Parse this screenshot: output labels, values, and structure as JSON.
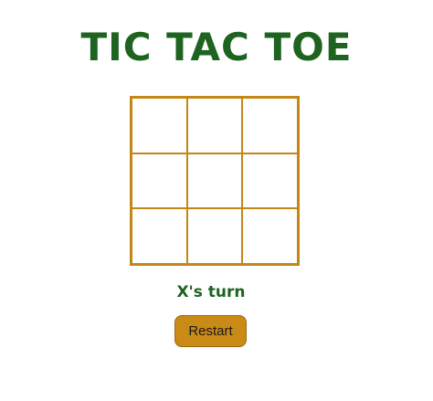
{
  "game": {
    "title": "TIC TAC TOE",
    "status": "X's turn",
    "restart_label": "Restart",
    "board": [
      "",
      "",
      "",
      "",
      "",
      "",
      "",
      "",
      ""
    ]
  },
  "colors": {
    "title": "#1e6420",
    "grid": "#c48716",
    "button": "#c98a16",
    "background": "#ffffff"
  }
}
